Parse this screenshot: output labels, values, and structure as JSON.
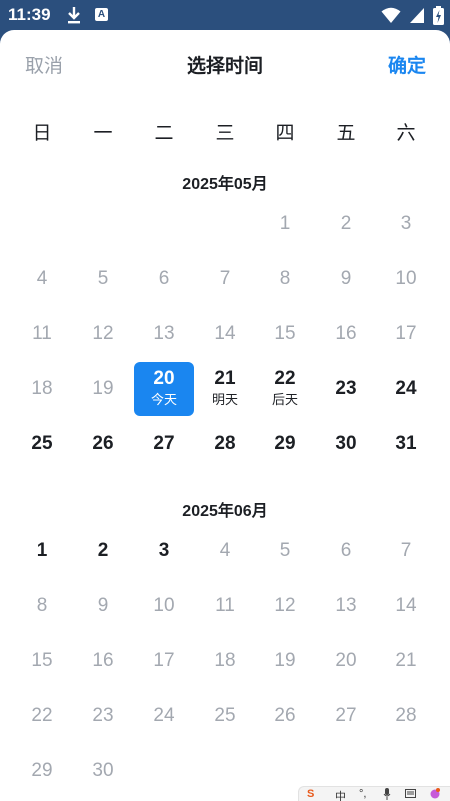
{
  "status": {
    "time": "11:39",
    "keyboard_badge": "A"
  },
  "header": {
    "cancel": "取消",
    "title": "选择时间",
    "confirm": "确定"
  },
  "weekdays": [
    "日",
    "一",
    "二",
    "三",
    "四",
    "五",
    "六"
  ],
  "months": [
    {
      "title": "2025年05月",
      "first_weekday": 4,
      "days": 31,
      "today": 20,
      "labels": {
        "20": "今天",
        "21": "明天",
        "22": "后天"
      }
    },
    {
      "title": "2025年06月",
      "first_weekday": 0,
      "days": 30,
      "future_until": 3,
      "labels": {}
    }
  ],
  "ime": {
    "logo": "S",
    "lang": "中",
    "punct": "°,"
  },
  "colors": {
    "accent": "#1a86f0",
    "past": "#a3a8b0",
    "text": "#1c1f24",
    "statusbar": "#2b4f7d"
  }
}
